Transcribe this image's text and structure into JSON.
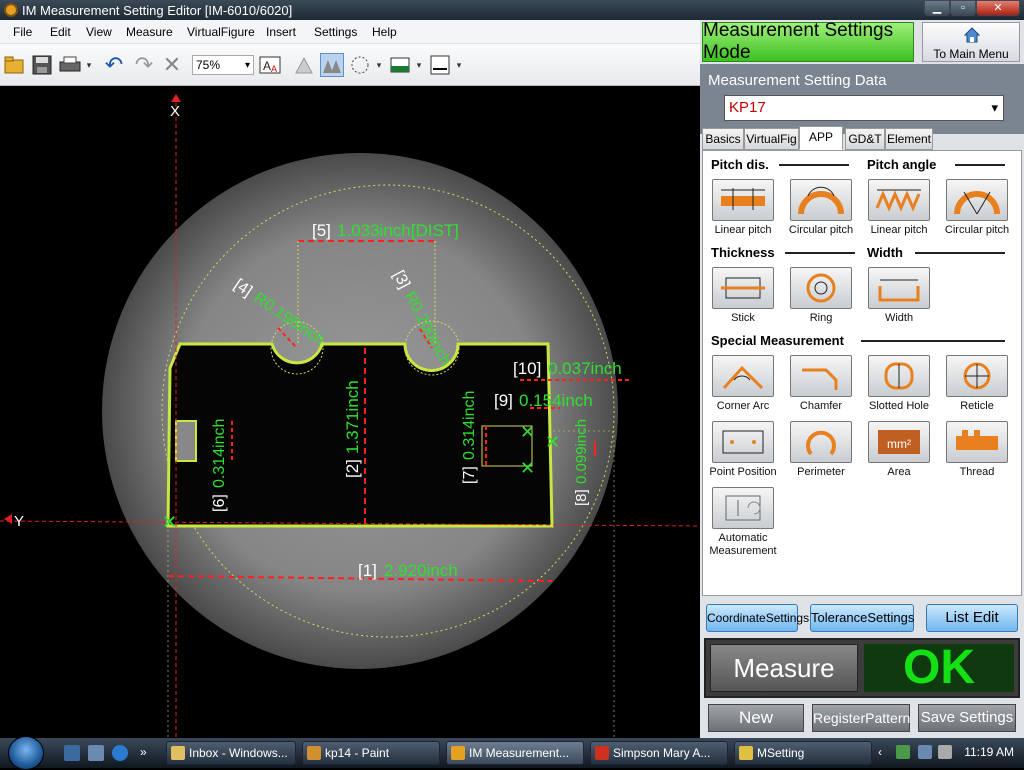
{
  "window": {
    "title": "IM Measurement Setting Editor  [IM-6010/6020]"
  },
  "menu": [
    "File",
    "Edit",
    "View",
    "Measure",
    "VirtualFigure",
    "Insert",
    "Settings",
    "Help"
  ],
  "toolbar": {
    "zoom": "75%"
  },
  "image": {
    "axis_x": "X",
    "axis_y": "Y",
    "labels": {
      "m1_idx": "[1]",
      "m1_val": "2.920inch",
      "m2_idx": "[2]",
      "m2_val": "1.371inch",
      "m3_idx": "[3]",
      "m3_val": "R0.200inch",
      "m4_idx": "[4]",
      "m4_val": "R0.196inch",
      "m5_idx": "[5]",
      "m5_val": "1.033inch[DIST]",
      "m6_idx": "[6]",
      "m6_val": "0.314inch",
      "m7_idx": "[7]",
      "m7_val": "0.314inch",
      "m8_idx": "[8]",
      "m8_val": "0.099inch",
      "m9_idx": "[9]",
      "m9_val": "0.154inch",
      "m10_idx": "[10]",
      "m10_val": "0.037inch"
    }
  },
  "panel": {
    "mode_label": "Measurement Settings Mode",
    "main_menu_label": "To Main Menu",
    "settings_title": "Measurement Setting Data",
    "selected_setting": "KP17",
    "tabs": [
      "Basics",
      "VirtualFig",
      "APP",
      "GD&T",
      "Element"
    ],
    "sections": {
      "pitch_dis": "Pitch dis.",
      "pitch_angle": "Pitch angle",
      "thickness": "Thickness",
      "width": "Width",
      "special": "Special Measurement"
    },
    "tools": {
      "linear_pitch_1": "Linear pitch",
      "circular_pitch_1": "Circular pitch",
      "linear_pitch_2": "Linear pitch",
      "circular_pitch_2": "Circular pitch",
      "stick": "Stick",
      "ring": "Ring",
      "width": "Width",
      "corner_arc": "Corner Arc",
      "chamfer": "Chamfer",
      "slotted_hole": "Slotted Hole",
      "reticle": "Reticle",
      "point_position": "Point Position",
      "perimeter": "Perimeter",
      "area": "Area",
      "area_icon_text": "mm²",
      "thread": "Thread",
      "automatic": "Automatic Measurement"
    },
    "buttons": {
      "coordinate": "CoordinateSettings",
      "tolerance": "ToleranceSettings",
      "list_edit": "List Edit",
      "measure": "Measure",
      "result": "OK",
      "new": "New",
      "register": "RegisterPattern",
      "save": "Save Settings"
    }
  },
  "taskbar": {
    "items": [
      "Inbox - Windows...",
      "kp14 - Paint",
      "IM Measurement...",
      "Simpson Mary A...",
      "MSetting"
    ],
    "clock": "11:19 AM"
  },
  "colors": {
    "accent_green": "#15e015",
    "measure_red": "#ff2020",
    "mode_green": "#3cc020"
  }
}
